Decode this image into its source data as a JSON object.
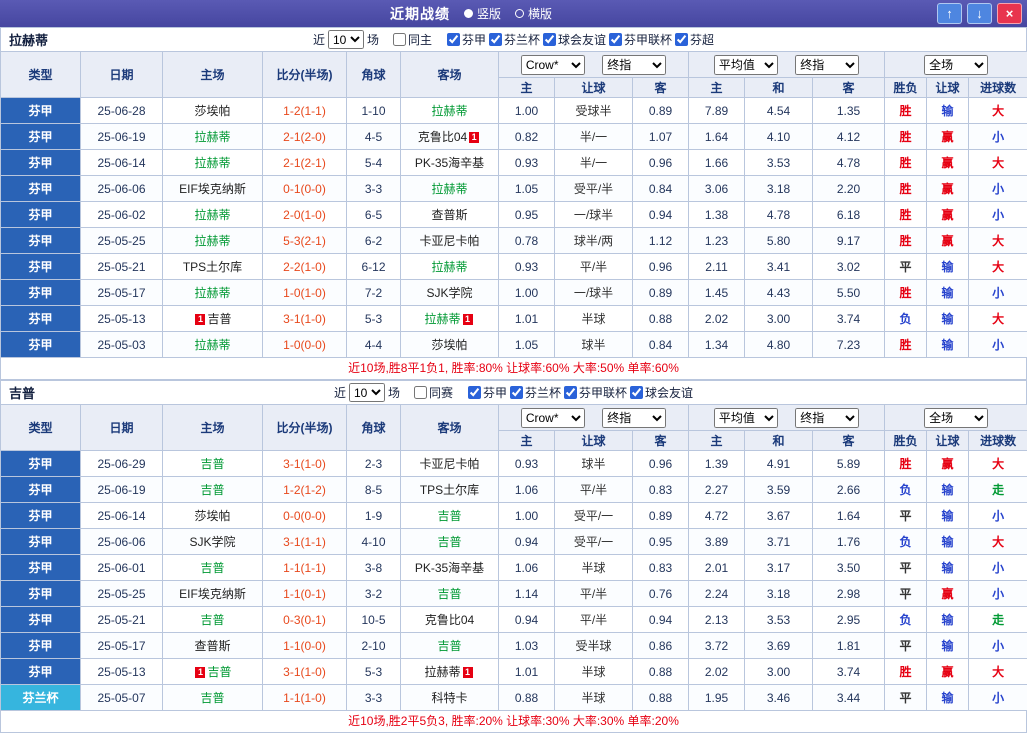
{
  "titlebar": {
    "title": "近期战绩",
    "radio_vertical": "竖版",
    "radio_horizontal": "横版",
    "up_icon": "↑",
    "down_icon": "↓",
    "close_icon": "×"
  },
  "colors": {
    "topbar_bg": "#4646a0",
    "btn_blue": "#4e86e0",
    "btn_red": "#e8344e",
    "header_bg": "#e9edf6",
    "header_text": "#1b3a7a",
    "border": "#b9c6dd",
    "row_alt": "#fbfdff",
    "score": "#e8491d",
    "focus_team": "#009933",
    "summary": "#e60012",
    "num_text": "#24365c",
    "league_default": "#2a63b6"
  },
  "league_colors": {
    "芬甲": "#2a63b6",
    "芬兰杯": "#36b5de"
  },
  "result_colors": {
    "胜": "#e60012",
    "赢": "#e60012",
    "大": "#e60012",
    "平": "#333333",
    "负": "#2743cd",
    "输": "#2743cd",
    "小": "#2743cd",
    "走": "#009933"
  },
  "table_header": {
    "type": "类型",
    "date": "日期",
    "home": "主场",
    "score": "比分(半场)",
    "corners": "角球",
    "away": "客场",
    "odds_source": "Crow*",
    "final_index": "终指",
    "average": "平均值",
    "full_match": "全场",
    "home_odds": "主",
    "handicap": "让球",
    "away_odds": "客",
    "draw": "和",
    "wdl": "胜负",
    "goals": "进球数"
  },
  "sections": [
    {
      "team": "拉赫蒂",
      "filter": {
        "prefix": "近",
        "count": "10",
        "suffix": "场",
        "same_label": "同主",
        "same_checked": false,
        "leagues": [
          {
            "label": "芬甲",
            "checked": true
          },
          {
            "label": "芬兰杯",
            "checked": true
          },
          {
            "label": "球会友谊",
            "checked": true
          },
          {
            "label": "芬甲联杯",
            "checked": true
          },
          {
            "label": "芬超",
            "checked": true
          }
        ]
      },
      "rows": [
        {
          "league": "芬甲",
          "date": "25-06-28",
          "home": "莎埃帕",
          "home_focus": false,
          "score": "1-2(1-1)",
          "corners": "1-10",
          "away": "拉赫蒂",
          "away_focus": true,
          "odds_home": "1.00",
          "handicap": "受球半",
          "odds_away": "0.89",
          "avg_home": "7.89",
          "avg_draw": "4.54",
          "avg_away": "1.35",
          "res_wdl": "胜",
          "res_handicap": "输",
          "res_goals": "大"
        },
        {
          "league": "芬甲",
          "date": "25-06-19",
          "home": "拉赫蒂",
          "home_focus": true,
          "score": "2-1(2-0)",
          "corners": "4-5",
          "away": "克鲁比04",
          "away_focus": false,
          "away_card_post": "1",
          "odds_home": "0.82",
          "handicap": "半/一",
          "odds_away": "1.07",
          "avg_home": "1.64",
          "avg_draw": "4.10",
          "avg_away": "4.12",
          "res_wdl": "胜",
          "res_handicap": "赢",
          "res_goals": "小"
        },
        {
          "league": "芬甲",
          "date": "25-06-14",
          "home": "拉赫蒂",
          "home_focus": true,
          "score": "2-1(2-1)",
          "corners": "5-4",
          "away": "PK-35海辛基",
          "away_focus": false,
          "odds_home": "0.93",
          "handicap": "半/一",
          "odds_away": "0.96",
          "avg_home": "1.66",
          "avg_draw": "3.53",
          "avg_away": "4.78",
          "res_wdl": "胜",
          "res_handicap": "赢",
          "res_goals": "大"
        },
        {
          "league": "芬甲",
          "date": "25-06-06",
          "home": "EIF埃克纳斯",
          "home_focus": false,
          "score": "0-1(0-0)",
          "corners": "3-3",
          "away": "拉赫蒂",
          "away_focus": true,
          "odds_home": "1.05",
          "handicap": "受平/半",
          "odds_away": "0.84",
          "avg_home": "3.06",
          "avg_draw": "3.18",
          "avg_away": "2.20",
          "res_wdl": "胜",
          "res_handicap": "赢",
          "res_goals": "小"
        },
        {
          "league": "芬甲",
          "date": "25-06-02",
          "home": "拉赫蒂",
          "home_focus": true,
          "score": "2-0(1-0)",
          "corners": "6-5",
          "away": "查普斯",
          "away_focus": false,
          "odds_home": "0.95",
          "handicap": "一/球半",
          "odds_away": "0.94",
          "avg_home": "1.38",
          "avg_draw": "4.78",
          "avg_away": "6.18",
          "res_wdl": "胜",
          "res_handicap": "赢",
          "res_goals": "小"
        },
        {
          "league": "芬甲",
          "date": "25-05-25",
          "home": "拉赫蒂",
          "home_focus": true,
          "score": "5-3(2-1)",
          "corners": "6-2",
          "away": "卡亚尼卡帕",
          "away_focus": false,
          "odds_home": "0.78",
          "handicap": "球半/两",
          "odds_away": "1.12",
          "avg_home": "1.23",
          "avg_draw": "5.80",
          "avg_away": "9.17",
          "res_wdl": "胜",
          "res_handicap": "赢",
          "res_goals": "大"
        },
        {
          "league": "芬甲",
          "date": "25-05-21",
          "home": "TPS土尔库",
          "home_focus": false,
          "score": "2-2(1-0)",
          "corners": "6-12",
          "away": "拉赫蒂",
          "away_focus": true,
          "odds_home": "0.93",
          "handicap": "平/半",
          "odds_away": "0.96",
          "avg_home": "2.11",
          "avg_draw": "3.41",
          "avg_away": "3.02",
          "res_wdl": "平",
          "res_handicap": "输",
          "res_goals": "大"
        },
        {
          "league": "芬甲",
          "date": "25-05-17",
          "home": "拉赫蒂",
          "home_focus": true,
          "score": "1-0(1-0)",
          "corners": "7-2",
          "away": "SJK学院",
          "away_focus": false,
          "odds_home": "1.00",
          "handicap": "一/球半",
          "odds_away": "0.89",
          "avg_home": "1.45",
          "avg_draw": "4.43",
          "avg_away": "5.50",
          "res_wdl": "胜",
          "res_handicap": "输",
          "res_goals": "小"
        },
        {
          "league": "芬甲",
          "date": "25-05-13",
          "home": "吉普",
          "home_focus": false,
          "home_card_pre": "1",
          "score": "3-1(1-0)",
          "corners": "5-3",
          "away": "拉赫蒂",
          "away_focus": true,
          "away_card_post": "1",
          "odds_home": "1.01",
          "handicap": "半球",
          "odds_away": "0.88",
          "avg_home": "2.02",
          "avg_draw": "3.00",
          "avg_away": "3.74",
          "res_wdl": "负",
          "res_handicap": "输",
          "res_goals": "大"
        },
        {
          "league": "芬甲",
          "date": "25-05-03",
          "home": "拉赫蒂",
          "home_focus": true,
          "score": "1-0(0-0)",
          "corners": "4-4",
          "away": "莎埃帕",
          "away_focus": false,
          "odds_home": "1.05",
          "handicap": "球半",
          "odds_away": "0.84",
          "avg_home": "1.34",
          "avg_draw": "4.80",
          "avg_away": "7.23",
          "res_wdl": "胜",
          "res_handicap": "输",
          "res_goals": "小"
        }
      ],
      "summary": "近10场,胜8平1负1, 胜率:80% 让球率:60% 大率:50% 单率:60%"
    },
    {
      "team": "吉普",
      "filter": {
        "prefix": "近",
        "count": "10",
        "suffix": "场",
        "same_label": "同赛",
        "same_checked": false,
        "leagues": [
          {
            "label": "芬甲",
            "checked": true
          },
          {
            "label": "芬兰杯",
            "checked": true
          },
          {
            "label": "芬甲联杯",
            "checked": true
          },
          {
            "label": "球会友谊",
            "checked": true
          }
        ]
      },
      "rows": [
        {
          "league": "芬甲",
          "date": "25-06-29",
          "home": "吉普",
          "home_focus": true,
          "score": "3-1(1-0)",
          "corners": "2-3",
          "away": "卡亚尼卡帕",
          "away_focus": false,
          "odds_home": "0.93",
          "handicap": "球半",
          "odds_away": "0.96",
          "avg_home": "1.39",
          "avg_draw": "4.91",
          "avg_away": "5.89",
          "res_wdl": "胜",
          "res_handicap": "赢",
          "res_goals": "大"
        },
        {
          "league": "芬甲",
          "date": "25-06-19",
          "home": "吉普",
          "home_focus": true,
          "score": "1-2(1-2)",
          "corners": "8-5",
          "away": "TPS土尔库",
          "away_focus": false,
          "odds_home": "1.06",
          "handicap": "平/半",
          "odds_away": "0.83",
          "avg_home": "2.27",
          "avg_draw": "3.59",
          "avg_away": "2.66",
          "res_wdl": "负",
          "res_handicap": "输",
          "res_goals": "走"
        },
        {
          "league": "芬甲",
          "date": "25-06-14",
          "home": "莎埃帕",
          "home_focus": false,
          "score": "0-0(0-0)",
          "corners": "1-9",
          "away": "吉普",
          "away_focus": true,
          "odds_home": "1.00",
          "handicap": "受平/一",
          "odds_away": "0.89",
          "avg_home": "4.72",
          "avg_draw": "3.67",
          "avg_away": "1.64",
          "res_wdl": "平",
          "res_handicap": "输",
          "res_goals": "小"
        },
        {
          "league": "芬甲",
          "date": "25-06-06",
          "home": "SJK学院",
          "home_focus": false,
          "score": "3-1(1-1)",
          "corners": "4-10",
          "away": "吉普",
          "away_focus": true,
          "odds_home": "0.94",
          "handicap": "受平/一",
          "odds_away": "0.95",
          "avg_home": "3.89",
          "avg_draw": "3.71",
          "avg_away": "1.76",
          "res_wdl": "负",
          "res_handicap": "输",
          "res_goals": "大"
        },
        {
          "league": "芬甲",
          "date": "25-06-01",
          "home": "吉普",
          "home_focus": true,
          "score": "1-1(1-1)",
          "corners": "3-8",
          "away": "PK-35海辛基",
          "away_focus": false,
          "odds_home": "1.06",
          "handicap": "半球",
          "odds_away": "0.83",
          "avg_home": "2.01",
          "avg_draw": "3.17",
          "avg_away": "3.50",
          "res_wdl": "平",
          "res_handicap": "输",
          "res_goals": "小"
        },
        {
          "league": "芬甲",
          "date": "25-05-25",
          "home": "EIF埃克纳斯",
          "home_focus": false,
          "score": "1-1(0-1)",
          "corners": "3-2",
          "away": "吉普",
          "away_focus": true,
          "odds_home": "1.14",
          "handicap": "平/半",
          "odds_away": "0.76",
          "avg_home": "2.24",
          "avg_draw": "3.18",
          "avg_away": "2.98",
          "res_wdl": "平",
          "res_handicap": "赢",
          "res_goals": "小"
        },
        {
          "league": "芬甲",
          "date": "25-05-21",
          "home": "吉普",
          "home_focus": true,
          "score": "0-3(0-1)",
          "corners": "10-5",
          "away": "克鲁比04",
          "away_focus": false,
          "odds_home": "0.94",
          "handicap": "平/半",
          "odds_away": "0.94",
          "avg_home": "2.13",
          "avg_draw": "3.53",
          "avg_away": "2.95",
          "res_wdl": "负",
          "res_handicap": "输",
          "res_goals": "走"
        },
        {
          "league": "芬甲",
          "date": "25-05-17",
          "home": "查普斯",
          "home_focus": false,
          "score": "1-1(0-0)",
          "corners": "2-10",
          "away": "吉普",
          "away_focus": true,
          "odds_home": "1.03",
          "handicap": "受半球",
          "odds_away": "0.86",
          "avg_home": "3.72",
          "avg_draw": "3.69",
          "avg_away": "1.81",
          "res_wdl": "平",
          "res_handicap": "输",
          "res_goals": "小"
        },
        {
          "league": "芬甲",
          "date": "25-05-13",
          "home": "吉普",
          "home_focus": true,
          "home_card_pre": "1",
          "score": "3-1(1-0)",
          "corners": "5-3",
          "away": "拉赫蒂",
          "away_focus": false,
          "away_card_post": "1",
          "odds_home": "1.01",
          "handicap": "半球",
          "odds_away": "0.88",
          "avg_home": "2.02",
          "avg_draw": "3.00",
          "avg_away": "3.74",
          "res_wdl": "胜",
          "res_handicap": "赢",
          "res_goals": "大"
        },
        {
          "league": "芬兰杯",
          "date": "25-05-07",
          "home": "吉普",
          "home_focus": true,
          "score": "1-1(1-0)",
          "corners": "3-3",
          "away": "科特卡",
          "away_focus": false,
          "odds_home": "0.88",
          "handicap": "半球",
          "odds_away": "0.88",
          "avg_home": "1.95",
          "avg_draw": "3.46",
          "avg_away": "3.44",
          "res_wdl": "平",
          "res_handicap": "输",
          "res_goals": "小"
        }
      ],
      "summary": "近10场,胜2平5负3, 胜率:20% 让球率:30% 大率:30% 单率:20%"
    }
  ]
}
